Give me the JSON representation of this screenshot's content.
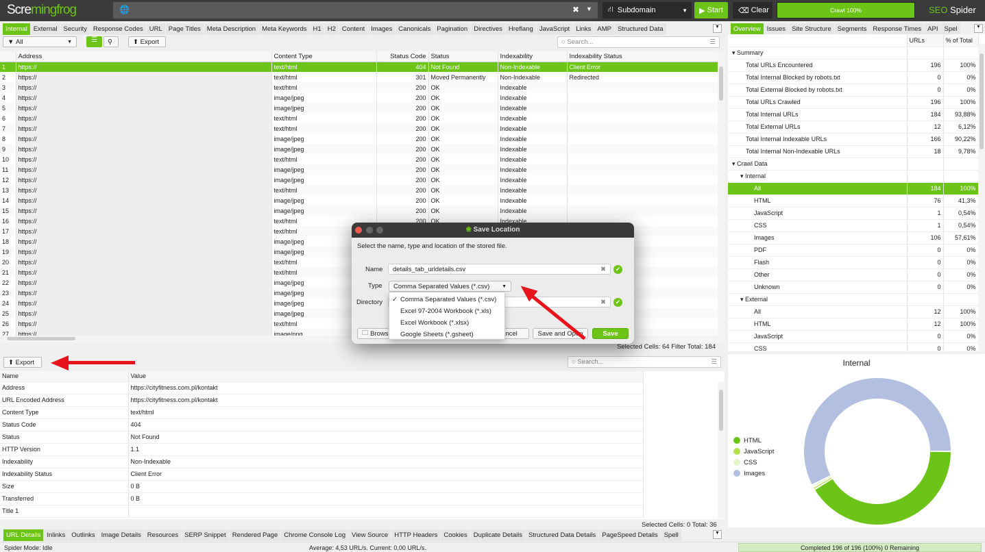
{
  "app": {
    "logo_left": "Scre",
    "logo_mid": "ming",
    "logo_right": "frog",
    "product": "SEO Spider",
    "product_accent": "SEO",
    "brand_color": "#6cc417"
  },
  "topbar": {
    "url_value": "",
    "mode": "Subdomain",
    "start": "Start",
    "clear": "Clear",
    "progress_label": "Crawl 100%",
    "progress": 100
  },
  "main_tabs": [
    "Internal",
    "External",
    "Security",
    "Response Codes",
    "URL",
    "Page Titles",
    "Meta Description",
    "Meta Keywords",
    "H1",
    "H2",
    "Content",
    "Images",
    "Canonicals",
    "Pagination",
    "Directives",
    "Hreflang",
    "JavaScript",
    "Links",
    "AMP",
    "Structured Data"
  ],
  "toolbar": {
    "filter": "All",
    "export": "Export",
    "search_placeholder": "Search..."
  },
  "grid": {
    "columns": [
      "Address",
      "Content Type",
      "Status Code",
      "Status",
      "Indexability",
      "Indexability Status"
    ],
    "rows": [
      [
        "1",
        "https://",
        "text/html",
        "404",
        "Not Found",
        "Non-Indexable",
        "Client Error"
      ],
      [
        "2",
        "https://",
        "text/html",
        "301",
        "Moved Permanently",
        "Non-Indexable",
        "Redirected"
      ],
      [
        "3",
        "https://",
        "text/html",
        "200",
        "OK",
        "Indexable",
        ""
      ],
      [
        "4",
        "https://",
        "image/jpeg",
        "200",
        "OK",
        "Indexable",
        ""
      ],
      [
        "5",
        "https://",
        "image/jpeg",
        "200",
        "OK",
        "Indexable",
        ""
      ],
      [
        "6",
        "https://",
        "text/html",
        "200",
        "OK",
        "Indexable",
        ""
      ],
      [
        "7",
        "https://",
        "text/html",
        "200",
        "OK",
        "Indexable",
        ""
      ],
      [
        "8",
        "https://",
        "image/jpeg",
        "200",
        "OK",
        "Indexable",
        ""
      ],
      [
        "9",
        "https://",
        "image/jpeg",
        "200",
        "OK",
        "Indexable",
        ""
      ],
      [
        "10",
        "https://",
        "text/html",
        "200",
        "OK",
        "Indexable",
        ""
      ],
      [
        "11",
        "https://",
        "image/jpeg",
        "200",
        "OK",
        "Indexable",
        ""
      ],
      [
        "12",
        "https://",
        "image/jpeg",
        "200",
        "OK",
        "Indexable",
        ""
      ],
      [
        "13",
        "https://",
        "text/html",
        "200",
        "OK",
        "Indexable",
        ""
      ],
      [
        "14",
        "https://",
        "image/jpeg",
        "200",
        "OK",
        "Indexable",
        ""
      ],
      [
        "15",
        "https://",
        "image/jpeg",
        "200",
        "OK",
        "Indexable",
        ""
      ],
      [
        "16",
        "https://",
        "text/html",
        "200",
        "OK",
        "Indexable",
        ""
      ],
      [
        "17",
        "https://",
        "text/html",
        "",
        "",
        "",
        ""
      ],
      [
        "18",
        "https://",
        "image/jpeg",
        "",
        "",
        "",
        ""
      ],
      [
        "19",
        "https://",
        "image/jpeg",
        "",
        "",
        "",
        ""
      ],
      [
        "20",
        "https://",
        "text/html",
        "",
        "",
        "",
        ""
      ],
      [
        "21",
        "https://",
        "text/html",
        "",
        "",
        "",
        ""
      ],
      [
        "22",
        "https://",
        "image/jpeg",
        "",
        "",
        "",
        ""
      ],
      [
        "23",
        "https://",
        "image/jpeg",
        "",
        "",
        "",
        ""
      ],
      [
        "24",
        "https://",
        "image/jpeg",
        "",
        "",
        "",
        ""
      ],
      [
        "25",
        "https://",
        "image/jpeg",
        "",
        "",
        "",
        ""
      ],
      [
        "26",
        "https://",
        "text/html",
        "",
        "",
        "",
        ""
      ],
      [
        "27",
        "https://",
        "image/png",
        "",
        "",
        "",
        ""
      ]
    ],
    "footer": "Selected Cells:  64  Filter Total:  184"
  },
  "right_tabs": [
    "Overview",
    "Issues",
    "Site Structure",
    "Segments",
    "Response Times",
    "API",
    "Spel"
  ],
  "overview": {
    "columns": [
      "",
      "URLs",
      "% of Total"
    ],
    "rows": [
      {
        "label": "Summary",
        "urls": "",
        "pct": "",
        "level": 0,
        "group": true
      },
      {
        "label": "Total URLs Encountered",
        "urls": "196",
        "pct": "100%",
        "level": 1
      },
      {
        "label": "Total Internal Blocked by robots.txt",
        "urls": "0",
        "pct": "0%",
        "level": 1
      },
      {
        "label": "Total External Blocked by robots.txt",
        "urls": "0",
        "pct": "0%",
        "level": 1
      },
      {
        "label": "Total URLs Crawled",
        "urls": "196",
        "pct": "100%",
        "level": 1
      },
      {
        "label": "Total Internal URLs",
        "urls": "184",
        "pct": "93,88%",
        "level": 1
      },
      {
        "label": "Total External URLs",
        "urls": "12",
        "pct": "6,12%",
        "level": 1
      },
      {
        "label": "Total Internal Indexable URLs",
        "urls": "166",
        "pct": "90,22%",
        "level": 1
      },
      {
        "label": "Total Internal Non-Indexable URLs",
        "urls": "18",
        "pct": "9,78%",
        "level": 1
      },
      {
        "label": "Crawl Data",
        "urls": "",
        "pct": "",
        "level": 0,
        "group": true
      },
      {
        "label": "Internal",
        "urls": "",
        "pct": "",
        "level": 1,
        "group": true
      },
      {
        "label": "All",
        "urls": "184",
        "pct": "100%",
        "level": 2,
        "selected": true
      },
      {
        "label": "HTML",
        "urls": "76",
        "pct": "41,3%",
        "level": 2
      },
      {
        "label": "JavaScript",
        "urls": "1",
        "pct": "0,54%",
        "level": 2
      },
      {
        "label": "CSS",
        "urls": "1",
        "pct": "0,54%",
        "level": 2
      },
      {
        "label": "Images",
        "urls": "106",
        "pct": "57,61%",
        "level": 2
      },
      {
        "label": "PDF",
        "urls": "0",
        "pct": "0%",
        "level": 2
      },
      {
        "label": "Flash",
        "urls": "0",
        "pct": "0%",
        "level": 2
      },
      {
        "label": "Other",
        "urls": "0",
        "pct": "0%",
        "level": 2
      },
      {
        "label": "Unknown",
        "urls": "0",
        "pct": "0%",
        "level": 2
      },
      {
        "label": "External",
        "urls": "",
        "pct": "",
        "level": 1,
        "group": true
      },
      {
        "label": "All",
        "urls": "12",
        "pct": "100%",
        "level": 2
      },
      {
        "label": "HTML",
        "urls": "12",
        "pct": "100%",
        "level": 2
      },
      {
        "label": "JavaScript",
        "urls": "0",
        "pct": "0%",
        "level": 2
      },
      {
        "label": "CSS",
        "urls": "0",
        "pct": "0%",
        "level": 2
      }
    ]
  },
  "details": {
    "export": "Export",
    "search_placeholder": "Search...",
    "columns": [
      "Name",
      "Value"
    ],
    "rows": [
      [
        "Address",
        "https://cityfitness.com.pl/kontakt"
      ],
      [
        "URL Encoded Address",
        "https://cityfitness.com.pl/kontakt"
      ],
      [
        "Content Type",
        "text/html"
      ],
      [
        "Status Code",
        "404"
      ],
      [
        "Status",
        "Not Found"
      ],
      [
        "HTTP Version",
        "1.1"
      ],
      [
        "Indexability",
        "Non-Indexable"
      ],
      [
        "Indexability Status",
        "Client Error"
      ],
      [
        "Size",
        "0 B"
      ],
      [
        "Transferred",
        "0 B"
      ],
      [
        "Title 1",
        ""
      ]
    ],
    "footer": "Selected Cells:  0  Total:  36"
  },
  "chart_data": {
    "type": "pie",
    "title": "Internal",
    "categories": [
      "HTML",
      "JavaScript",
      "CSS",
      "Images"
    ],
    "values": [
      76,
      1,
      1,
      106
    ],
    "colors": [
      "#6cc417",
      "#b5e04a",
      "#e4f5c8",
      "#b3bfe0"
    ],
    "legend": "left",
    "donut": true
  },
  "bottom_tabs": [
    "URL Details",
    "Inlinks",
    "Outlinks",
    "Image Details",
    "Resources",
    "SERP Snippet",
    "Rendered Page",
    "Chrome Console Log",
    "View Source",
    "HTTP Headers",
    "Cookies",
    "Duplicate Details",
    "Structured Data Details",
    "PageSpeed Details",
    "Spell"
  ],
  "status": {
    "mode": "Spider Mode: Idle",
    "speed": "Average: 4,53 URL/s. Current: 0,00 URL/s.",
    "completed": "Completed 196 of 196 (100%) 0 Remaining"
  },
  "dialog": {
    "title": "Save Location",
    "instructions": "Select the name, type and location of the stored file.",
    "name_label": "Name",
    "name_value": "details_tab_urldetails.csv",
    "type_label": "Type",
    "type_value": "Comma Separated Values (*.csv)",
    "directory_label": "Directory",
    "directory_value": "",
    "browse": "Browse",
    "cancel": "Cancel",
    "save_open": "Save and Open",
    "save": "Save",
    "type_options": [
      "Comma Separated Values (*.csv)",
      "Excel 97-2004 Workbook (*.xls)",
      "Excel Workbook (*.xlsx)",
      "Google Sheets (*.gsheet)"
    ],
    "selected_option": 0
  }
}
